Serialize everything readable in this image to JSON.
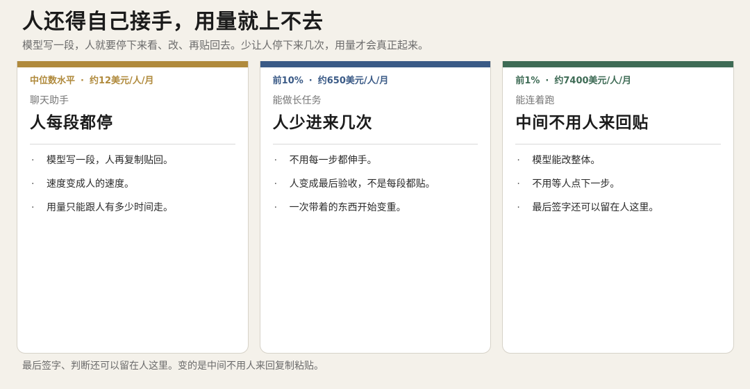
{
  "header": {
    "title": "人还得自己接手，用量就上不去",
    "subtitle": "模型写一段，人就要停下来看、改、再贴回去。少让人停下来几次，用量才会真正起来。"
  },
  "colors": {
    "background": "#f4f1ea",
    "card_1_accent": "#b08a3c",
    "card_2_accent": "#3a5a86",
    "card_3_accent": "#3e6b55"
  },
  "cards": [
    {
      "tier": "中位数水平",
      "price": "约12美元/人/月",
      "subtitle": "聊天助手",
      "title": "人每段都停",
      "bullets": [
        "模型写一段，人再复制贴回。",
        "速度变成人的速度。",
        "用量只能跟人有多少时间走。"
      ]
    },
    {
      "tier": "前10%",
      "price": "约650美元/人/月",
      "subtitle": "能做长任务",
      "title": "人少进来几次",
      "bullets": [
        "不用每一步都伸手。",
        "人变成最后验收，不是每段都贴。",
        "一次带着的东西开始变重。"
      ]
    },
    {
      "tier": "前1%",
      "price": "约7400美元/人/月",
      "subtitle": "能连着跑",
      "title": "中间不用人来回贴",
      "bullets": [
        "模型能改整体。",
        "不用等人点下一步。",
        "最后签字还可以留在人这里。"
      ]
    }
  ],
  "meta_separator": "·",
  "bullet_glyph": "·",
  "footer": {
    "text": "最后签字、判断还可以留在人这里。变的是中间不用人来回复制粘贴。"
  }
}
